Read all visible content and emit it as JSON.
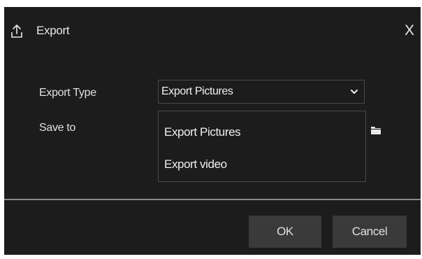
{
  "dialog": {
    "title": "Export",
    "title_icon": "export-icon",
    "close_label": "X"
  },
  "form": {
    "export_type_label": "Export Type",
    "export_type_value": "Export Pictures",
    "save_to_label": "Save to",
    "save_to_icon": "folder-icon"
  },
  "dropdown": {
    "options": [
      "Export Pictures",
      "Export video"
    ]
  },
  "buttons": {
    "ok_label": "OK",
    "cancel_label": "Cancel"
  },
  "colors": {
    "background": "#1c1c1c",
    "text": "#e6e6e6",
    "button": "#3a3a3a",
    "divider": "#8a8a8a",
    "border": "#4a4a4a"
  }
}
